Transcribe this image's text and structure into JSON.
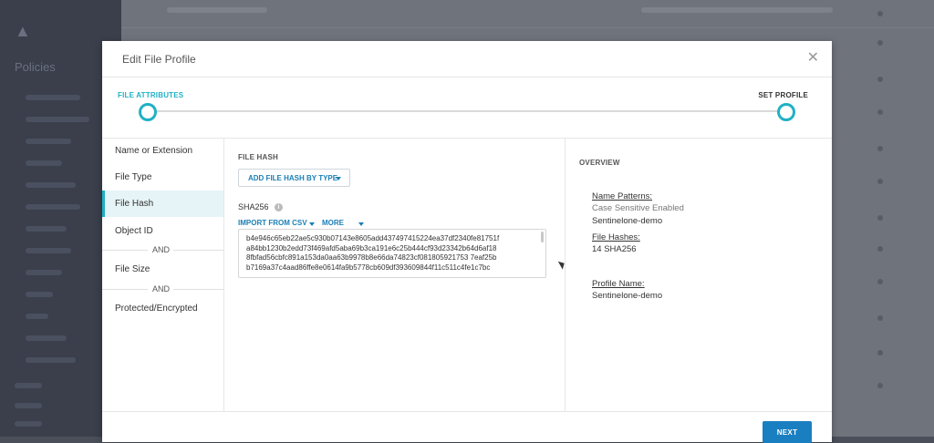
{
  "background": {
    "heading": "Policies"
  },
  "modal": {
    "title": "Edit File Profile",
    "close_icon": "close-icon"
  },
  "stepper": {
    "step1": "FILE ATTRIBUTES",
    "step2": "SET PROFILE"
  },
  "nav": {
    "items": [
      "Name or Extension",
      "File Type",
      "File Hash",
      "Object ID",
      "File Size",
      "Protected/Encrypted"
    ],
    "active": "File Hash",
    "and_label": "AND"
  },
  "file_hash": {
    "section_title": "FILE HASH",
    "add_button": "ADD FILE HASH BY TYPE",
    "sha_label": "SHA256",
    "import_link": "IMPORT FROM CSV",
    "more_link": "MORE",
    "hashes": [
      "b4e946c65eb22ae5c930b07143e8605add437497415224ea37df2340fe81751f",
      "a84bb1230b2edd73f469afd5aba69b3ca191e6c25b444cf93d23342b64d6af18",
      "8fbfad56cbfc891a153da0aa63b9978b8e66da74823cf081805921753 7eaf25b",
      "b7169a37c4aad86ffe8e0614fa9b5778cb609df393609844f11c511c4fe1c7bc"
    ]
  },
  "overview": {
    "title": "OVERVIEW",
    "name_patterns_label": "Name Patterns:",
    "case_sensitive": "Case Sensitive Enabled",
    "name_value": "Sentinelone-demo",
    "file_hashes_label": "File Hashes:",
    "file_hashes_value": "14 SHA256",
    "profile_name_label": "Profile Name:",
    "profile_name_value": "Sentinelone-demo"
  },
  "footer": {
    "next_button": "NEXT"
  },
  "colors": {
    "accent": "#1fb1c4",
    "link": "#1a7fb5",
    "primary_button": "#1a7fc1"
  }
}
